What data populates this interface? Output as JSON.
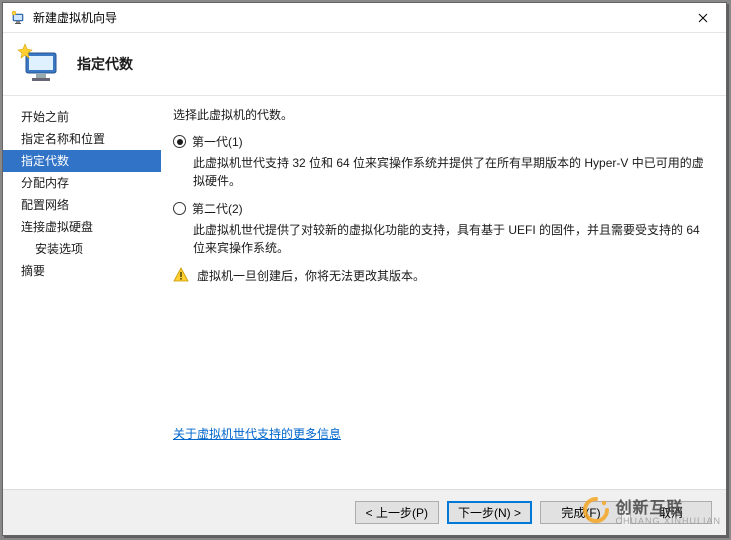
{
  "title": "新建虚拟机向导",
  "header": "指定代数",
  "sidebar": {
    "items": [
      {
        "label": "开始之前"
      },
      {
        "label": "指定名称和位置"
      },
      {
        "label": "指定代数",
        "active": true
      },
      {
        "label": "分配内存"
      },
      {
        "label": "配置网络"
      },
      {
        "label": "连接虚拟硬盘"
      },
      {
        "label": "安装选项",
        "sub": true
      },
      {
        "label": "摘要"
      }
    ]
  },
  "content": {
    "prompt": "选择此虚拟机的代数。",
    "options": [
      {
        "label": "第一代(1)",
        "selected": true,
        "desc": "此虚拟机世代支持 32 位和 64 位来宾操作系统并提供了在所有早期版本的 Hyper-V 中已可用的虚拟硬件。"
      },
      {
        "label": "第二代(2)",
        "selected": false,
        "desc": "此虚拟机世代提供了对较新的虚拟化功能的支持，具有基于 UEFI 的固件，并且需要受支持的 64 位来宾操作系统。"
      }
    ],
    "warning": "虚拟机一旦创建后，你将无法更改其版本。",
    "more_link": "关于虚拟机世代支持的更多信息"
  },
  "footer": {
    "prev": "< 上一步(P)",
    "next": "下一步(N) >",
    "finish": "完成(F)",
    "cancel": "取消"
  },
  "watermark": {
    "main": "创新互联",
    "sub": "CHUANG XINHULIAN"
  }
}
